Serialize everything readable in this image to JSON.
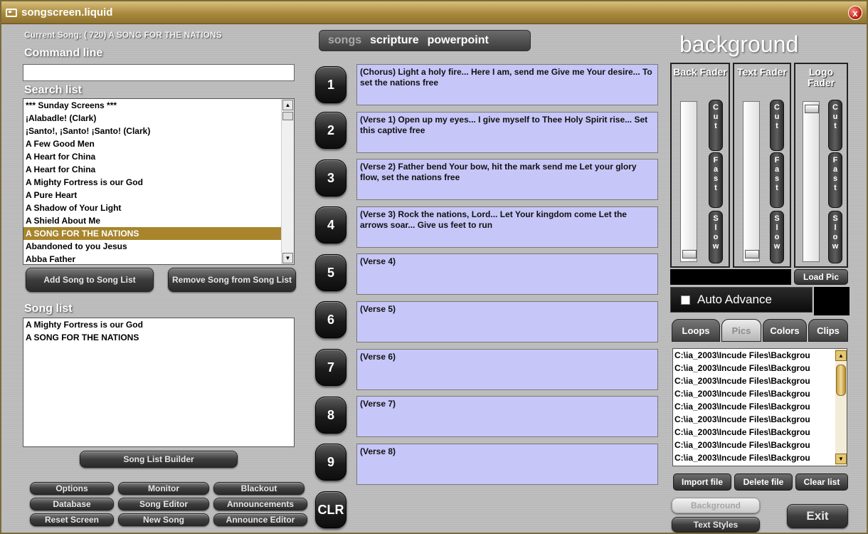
{
  "window": {
    "title": "songscreen.liquid",
    "close_label": "x"
  },
  "current_song": "Current Song: ( 720) A SONG FOR THE NATIONS",
  "command_line": {
    "label": "Command line",
    "value": ""
  },
  "search_list": {
    "label": "Search list",
    "items": [
      "*** Sunday Screens ***",
      "¡Alabadle! (Clark)",
      "¡Santo!, ¡Santo! ¡Santo! (Clark)",
      "A Few Good Men",
      "A Heart for China",
      "A Heart for China",
      "A Mighty Fortress is our God",
      "A Pure Heart",
      "A Shadow of Your Light",
      "A Shield About Me",
      "A SONG FOR THE NATIONS",
      "Abandoned to you Jesus",
      "Abba Father"
    ],
    "selected_index": 10
  },
  "list_buttons": {
    "add": "Add Song to Song List",
    "remove": "Remove Song from Song List"
  },
  "song_list": {
    "label": "Song list",
    "items": [
      "A Mighty Fortress is our God",
      "A SONG FOR THE NATIONS"
    ]
  },
  "song_list_builder": "Song List Builder",
  "bottom_buttons": {
    "options": "Options",
    "monitor": "Monitor",
    "blackout": "Blackout",
    "database": "Database",
    "song_editor": "Song Editor",
    "announcements": "Announcements",
    "reset_screen": "Reset Screen",
    "new_song": "New Song",
    "announce_editor": "Announce Editor"
  },
  "mode_tabs": {
    "songs": "songs",
    "scripture": "scripture",
    "powerpoint": "powerpoint"
  },
  "verse_buttons": [
    "1",
    "2",
    "3",
    "4",
    "5",
    "6",
    "7",
    "8",
    "9"
  ],
  "clr_label": "CLR",
  "verses": [
    "(Chorus) Light a holy fire... Here I am, send me Give me Your desire... To set the nations free",
    "(Verse 1) Open up my eyes... I give myself to Thee Holy Spirit rise... Set this captive free",
    "(Verse 2) Father bend Your bow, hit the mark send me Let your glory flow, set the nations free",
    "(Verse 3) Rock the nations, Lord... Let Your kingdom come Let the arrows soar... Give us feet to run",
    "(Verse 4)",
    "(Verse 5)",
    "(Verse 6)",
    "(Verse 7)",
    "(Verse 8)"
  ],
  "background": {
    "title": "background",
    "faders": {
      "back": {
        "title": "Back Fader",
        "level": 0.0
      },
      "text": {
        "title": "Text Fader",
        "level": 0.0
      },
      "logo": {
        "title": "Logo Fader",
        "level": 1.0
      }
    },
    "cut_label": "C u t",
    "fast_label": "F a s t",
    "slow_label": "S l o w",
    "load_pic": "Load Pic",
    "auto_advance": "Auto Advance",
    "tabs": {
      "loops": "Loops",
      "pics": "Pics",
      "colors": "Colors",
      "clips": "Clips"
    },
    "files": [
      "C:\\ia_2003\\Incude Files\\Backgrou",
      "C:\\ia_2003\\Incude Files\\Backgrou",
      "C:\\ia_2003\\Incude Files\\Backgrou",
      "C:\\ia_2003\\Incude Files\\Backgrou",
      "C:\\ia_2003\\Incude Files\\Backgrou",
      "C:\\ia_2003\\Incude Files\\Backgrou",
      "C:\\ia_2003\\Incude Files\\Backgrou",
      "C:\\ia_2003\\Incude Files\\Backgrou",
      "C:\\ia_2003\\Incude Files\\Backgrou"
    ],
    "import_file": "Import file",
    "delete_file": "Delete file",
    "clear_list": "Clear list",
    "background_btn": "Background",
    "text_styles": "Text Styles",
    "exit": "Exit"
  },
  "colors": {
    "accent": "#a8852c",
    "verse_bg": "#c7c6f8",
    "title_bar": "#a9893c"
  }
}
